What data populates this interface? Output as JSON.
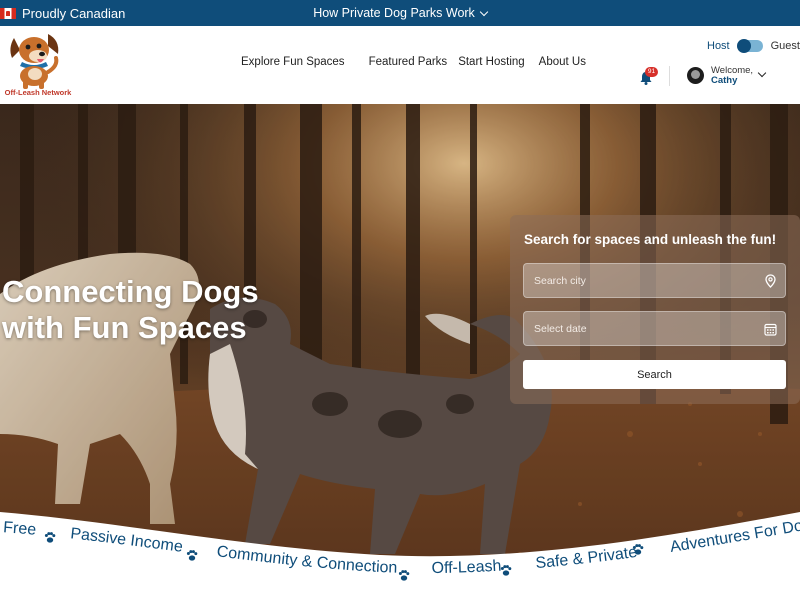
{
  "topbar": {
    "left_label": "Proudly Canadian",
    "center_label": "How Private Dog Parks Work"
  },
  "header": {
    "logo_text": "Off-Leash Network",
    "nav": [
      "Explore Fun Spaces",
      "Featured Parks",
      "Start Hosting",
      "About Us"
    ],
    "role_toggle": {
      "host_label": "Host",
      "guest_label": "Guest",
      "active": "Host"
    },
    "notifications_count": "91",
    "user": {
      "welcome": "Welcome,",
      "name": "Cathy"
    }
  },
  "hero": {
    "title_line1": "Connecting Dogs",
    "title_line2": "with Fun Spaces"
  },
  "search": {
    "heading": "Search for spaces and unleash the fun!",
    "city_placeholder": "Search city",
    "date_placeholder": "Select date",
    "button_label": "Search"
  },
  "ticker": {
    "items": [
      "Free",
      "Passive Income",
      "Community & Connection",
      "Off-Leash",
      "Safe & Private",
      "Adventures For Dog"
    ]
  },
  "colors": {
    "brand_blue": "#0f4d7a",
    "badge_red": "#d7302a",
    "logo_red": "#c0392b"
  },
  "icons": {
    "flag": "canada-flag-icon",
    "nav_chevron": "chevron-down-icon",
    "notifications": "bell-icon",
    "city": "map-pin-icon",
    "date": "calendar-icon",
    "separator": "paw-print-icon"
  }
}
